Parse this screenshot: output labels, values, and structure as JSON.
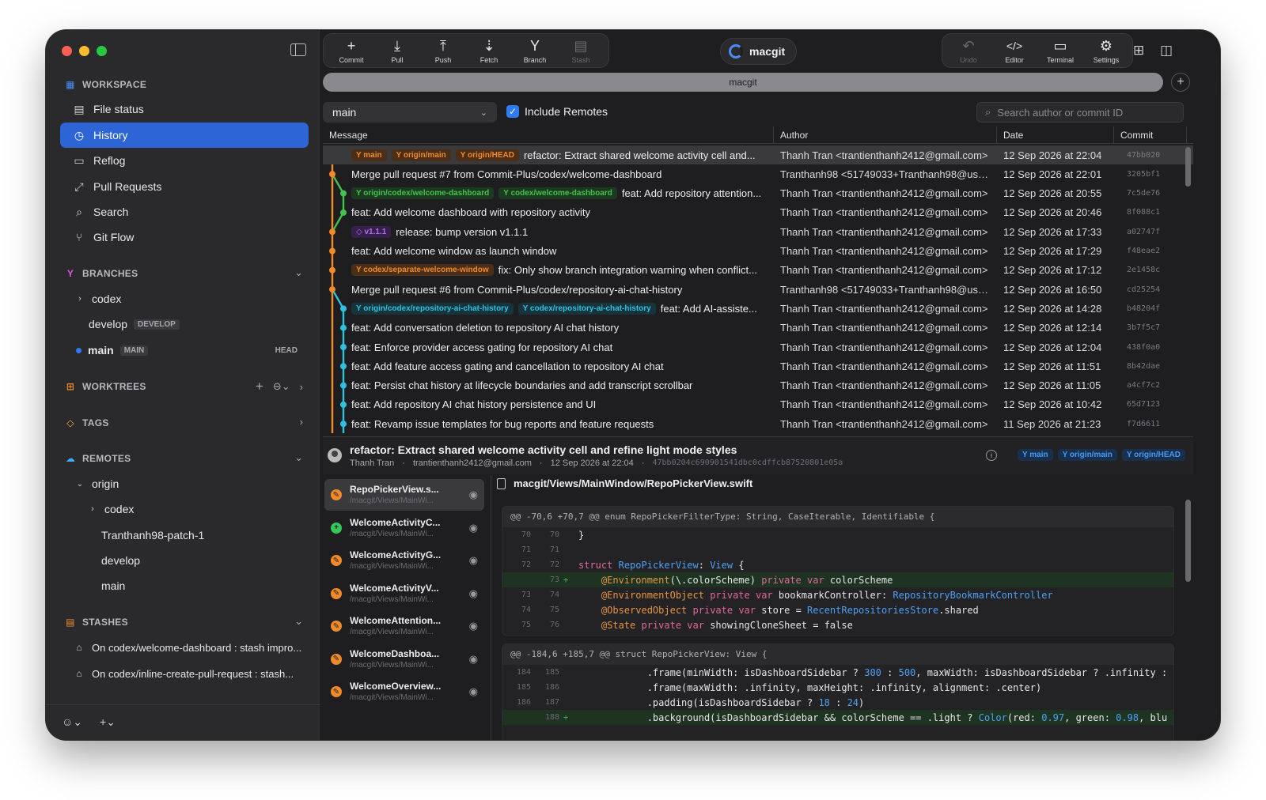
{
  "toolbar": {
    "left": [
      {
        "label": "Commit",
        "icon": "+"
      },
      {
        "label": "Pull",
        "icon": "⤓"
      },
      {
        "label": "Push",
        "icon": "⤒"
      },
      {
        "label": "Fetch",
        "icon": "⇣"
      },
      {
        "label": "Branch",
        "icon": "Y"
      },
      {
        "label": "Stash",
        "icon": "▤"
      }
    ],
    "app_name": "macgit",
    "right": [
      {
        "label": "Undo",
        "icon": "↶"
      },
      {
        "label": "Editor",
        "icon": "</>"
      },
      {
        "label": "Terminal",
        "icon": "▭"
      },
      {
        "label": "Settings",
        "icon": "⚙"
      }
    ]
  },
  "tab": {
    "title": "macgit",
    "add_icon": "+"
  },
  "filter": {
    "branch": "main",
    "include_remotes_label": "Include Remotes",
    "include_remotes_checked": true,
    "search_placeholder": "Search author or commit ID"
  },
  "sidebar": {
    "workspace_label": "WORKSPACE",
    "items": [
      {
        "label": "File status",
        "icon": "file-status-icon",
        "active": false
      },
      {
        "label": "History",
        "icon": "history-icon",
        "active": true
      },
      {
        "label": "Reflog",
        "icon": "reflog-icon",
        "active": false
      },
      {
        "label": "Pull Requests",
        "icon": "pull-request-icon",
        "active": false
      },
      {
        "label": "Search",
        "icon": "search-icon",
        "active": false
      },
      {
        "label": "Git Flow",
        "icon": "git-flow-icon",
        "active": false
      }
    ],
    "branches_label": "BRANCHES",
    "branches": {
      "codex": "codex",
      "develop": "develop",
      "develop_tag": "DEVELOP",
      "main": "main",
      "main_tag": "MAIN",
      "head": "HEAD"
    },
    "worktrees_label": "WORKTREES",
    "tags_label": "TAGS",
    "remotes_label": "REMOTES",
    "remotes": {
      "origin": "origin",
      "children": [
        "codex",
        "Tranthanh98-patch-1",
        "develop",
        "main"
      ]
    },
    "stashes_label": "STASHES",
    "stashes": [
      "On codex/welcome-dashboard : stash impro...",
      "On codex/inline-create-pull-request : stash..."
    ]
  },
  "table": {
    "columns": [
      "Message",
      "Author",
      "Date",
      "Commit"
    ],
    "rows": [
      {
        "refs": [
          [
            "main",
            "orange"
          ],
          [
            "origin/main",
            "orange"
          ],
          [
            "origin/HEAD",
            "orange"
          ]
        ],
        "message": "refactor: Extract shared welcome activity cell and...",
        "author": "Thanh Tran <trantienthanh2412@gmail.com>",
        "date": "12 Sep 2026 at 22:04",
        "hash": "47bb020"
      },
      {
        "refs": [],
        "message": "Merge pull request #7 from Commit-Plus/codex/welcome-dashboard",
        "author": "Tranthanh98 <51749033+Tranthanh98@use...",
        "date": "12 Sep 2026 at 22:01",
        "hash": "3205bf1"
      },
      {
        "refs": [
          [
            "origin/codex/welcome-dashboard",
            "green"
          ],
          [
            "codex/welcome-dashboard",
            "green"
          ]
        ],
        "message": "feat: Add repository attention...",
        "author": "Thanh Tran <trantienthanh2412@gmail.com>",
        "date": "12 Sep 2026 at 20:55",
        "hash": "7c5de76"
      },
      {
        "refs": [],
        "message": "feat: Add welcome dashboard with repository activity",
        "author": "Thanh Tran <trantienthanh2412@gmail.com>",
        "date": "12 Sep 2026 at 20:46",
        "hash": "8f088c1"
      },
      {
        "refs": [
          [
            "v1.1.1",
            "purple"
          ]
        ],
        "message": "release: bump version v1.1.1",
        "author": "Thanh Tran <trantienthanh2412@gmail.com>",
        "date": "12 Sep 2026 at 17:33",
        "hash": "a02747f"
      },
      {
        "refs": [],
        "message": "feat: Add welcome window as launch window",
        "author": "Thanh Tran <trantienthanh2412@gmail.com>",
        "date": "12 Sep 2026 at 17:29",
        "hash": "f48eae2"
      },
      {
        "refs": [
          [
            "codex/separate-welcome-window",
            "orange"
          ]
        ],
        "message": "fix: Only show branch integration warning when conflict...",
        "author": "Thanh Tran <trantienthanh2412@gmail.com>",
        "date": "12 Sep 2026 at 17:12",
        "hash": "2e1458c"
      },
      {
        "refs": [],
        "message": "Merge pull request #6 from Commit-Plus/codex/repository-ai-chat-history",
        "author": "Tranthanh98 <51749033+Tranthanh98@use...",
        "date": "12 Sep 2026 at 16:50",
        "hash": "cd25254"
      },
      {
        "refs": [
          [
            "origin/codex/repository-ai-chat-history",
            "cyan"
          ],
          [
            "codex/repository-ai-chat-history",
            "cyan"
          ]
        ],
        "message": "feat: Add AI-assiste...",
        "author": "Thanh Tran <trantienthanh2412@gmail.com>",
        "date": "12 Sep 2026 at 14:28",
        "hash": "b48204f"
      },
      {
        "refs": [],
        "message": "feat: Add conversation deletion to repository AI chat history",
        "author": "Thanh Tran <trantienthanh2412@gmail.com>",
        "date": "12 Sep 2026 at 12:14",
        "hash": "3b7f5c7"
      },
      {
        "refs": [],
        "message": "feat: Enforce provider access gating for repository AI chat",
        "author": "Thanh Tran <trantienthanh2412@gmail.com>",
        "date": "12 Sep 2026 at 12:04",
        "hash": "438f0a0"
      },
      {
        "refs": [],
        "message": "feat: Add feature access gating and cancellation to repository AI chat",
        "author": "Thanh Tran <trantienthanh2412@gmail.com>",
        "date": "12 Sep 2026 at 11:51",
        "hash": "8b42dae"
      },
      {
        "refs": [],
        "message": "feat: Persist chat history at lifecycle boundaries and add transcript scrollbar",
        "author": "Thanh Tran <trantienthanh2412@gmail.com>",
        "date": "12 Sep 2026 at 11:05",
        "hash": "a4cf7c2"
      },
      {
        "refs": [],
        "message": "feat: Add repository AI chat history persistence and UI",
        "author": "Thanh Tran <trantienthanh2412@gmail.com>",
        "date": "12 Sep 2026 at 10:42",
        "hash": "65d7123"
      },
      {
        "refs": [],
        "message": "feat: Revamp issue templates for bug reports and feature requests",
        "author": "Thanh Tran <trantienthanh2412@gmail.com>",
        "date": "11 Sep 2026 at 21:23",
        "hash": "f7d6611"
      }
    ]
  },
  "commit": {
    "title": "refactor: Extract shared welcome activity cell and refine light mode styles",
    "author": "Thanh Tran",
    "email": "trantienthanh2412@gmail.com",
    "date": "12 Sep 2026 at 22:04",
    "sha": "47bb0204c690901541dbc0cdffcb87520801e05a",
    "refs": [
      "main",
      "origin/main",
      "origin/HEAD"
    ]
  },
  "files": [
    {
      "name": "RepoPickerView.s...",
      "path": "/macgit/Views/MainWi...",
      "status": "modified"
    },
    {
      "name": "WelcomeActivityC...",
      "path": "/macgit/Views/MainWi...",
      "status": "added"
    },
    {
      "name": "WelcomeActivityG...",
      "path": "/macgit/Views/MainWi...",
      "status": "modified"
    },
    {
      "name": "WelcomeActivityV...",
      "path": "/macgit/Views/MainWi...",
      "status": "modified"
    },
    {
      "name": "WelcomeAttention...",
      "path": "/macgit/Views/MainWi...",
      "status": "modified"
    },
    {
      "name": "WelcomeDashboa...",
      "path": "/macgit/Views/MainWi...",
      "status": "modified"
    },
    {
      "name": "WelcomeOverview...",
      "path": "/macgit/Views/MainWi...",
      "status": "modified"
    }
  ],
  "diff": {
    "path": "macgit/Views/MainWindow/RepoPickerView.swift",
    "hunk1_header": "@@ -70,6 +70,7 @@ enum RepoPickerFilterType: String, CaseIterable, Identifiable {",
    "hunk2_header": "@@ -184,6 +185,7 @@ struct RepoPickerView: View {",
    "hunk1_numbers": [
      [
        "70",
        "70"
      ],
      [
        "71",
        "71"
      ],
      [
        "72",
        "72"
      ],
      [
        "",
        "73"
      ],
      [
        "73",
        "74"
      ],
      [
        "74",
        "75"
      ],
      [
        "75",
        "76"
      ]
    ],
    "hunk2_numbers": [
      [
        "184",
        "185"
      ],
      [
        "185",
        "186"
      ],
      [
        "186",
        "187"
      ],
      [
        "",
        "188"
      ]
    ]
  },
  "bottom": {
    "account_icon": "account-icon",
    "add_icon": "+"
  }
}
